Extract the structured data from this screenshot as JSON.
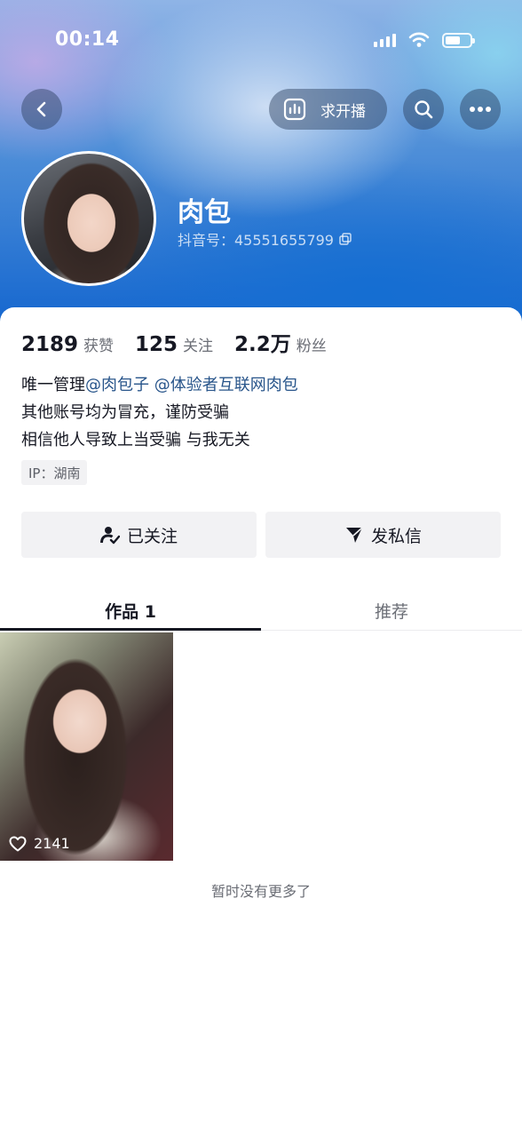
{
  "status_bar": {
    "time": "00:14"
  },
  "header": {
    "live_request_label": "求开播"
  },
  "profile": {
    "name": "肉包",
    "douyin_id": "抖音号：45551655799"
  },
  "stats": [
    {
      "value": "2189",
      "label": "获赞"
    },
    {
      "value": "125",
      "label": "关注"
    },
    {
      "value": "2.2万",
      "label": "粉丝"
    }
  ],
  "bio": {
    "line1_prefix": "唯一管理",
    "mention1": "@肉包子",
    "mention2": "@体验者互联网肉包",
    "line2": "其他账号均为冒充，谨防受骗",
    "line3": "相信他人导致上当受骗 与我无关"
  },
  "ip_location": "IP：湖南",
  "actions": {
    "follow_label": "已关注",
    "message_label": "发私信"
  },
  "tabs": [
    {
      "label": "作品 1",
      "active": true
    },
    {
      "label": "推荐",
      "active": false
    }
  ],
  "works": [
    {
      "likes": "2141"
    }
  ],
  "footer_text": "暂时没有更多了",
  "colors": {
    "mention": "#27548a",
    "banner_blue": "#1466cf"
  }
}
